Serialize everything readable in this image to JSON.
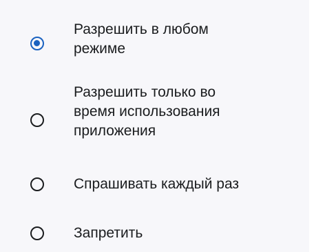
{
  "permission_options": [
    {
      "label": "Разрешить в любом\nрежиме",
      "selected": true
    },
    {
      "label": "Разрешить только во\nвремя использования\nприложения",
      "selected": false
    },
    {
      "label": "Спрашивать каждый раз",
      "selected": false
    },
    {
      "label": "Запретить",
      "selected": false
    }
  ],
  "colors": {
    "accent": "#1a62c0",
    "text": "#1a1c1e",
    "background": "#f7f7fa"
  }
}
